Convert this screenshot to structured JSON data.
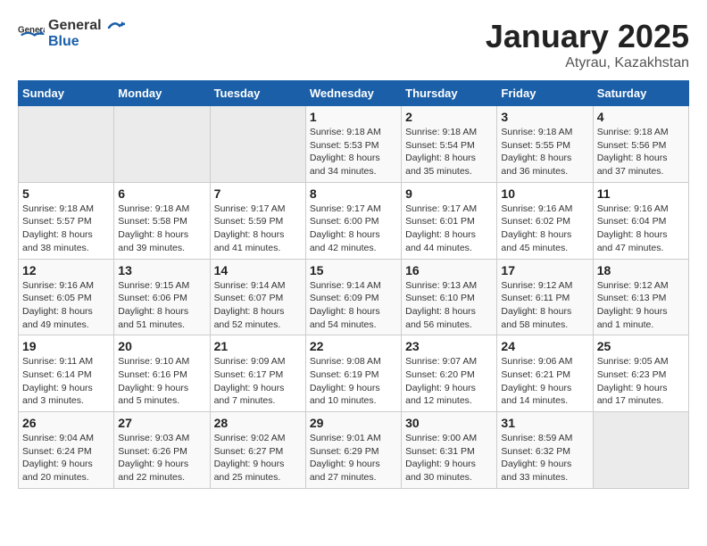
{
  "header": {
    "logo_general": "General",
    "logo_blue": "Blue",
    "title": "January 2025",
    "subtitle": "Atyrau, Kazakhstan"
  },
  "weekdays": [
    "Sunday",
    "Monday",
    "Tuesday",
    "Wednesday",
    "Thursday",
    "Friday",
    "Saturday"
  ],
  "weeks": [
    [
      {
        "day": "",
        "sunrise": "",
        "sunset": "",
        "daylight": ""
      },
      {
        "day": "",
        "sunrise": "",
        "sunset": "",
        "daylight": ""
      },
      {
        "day": "",
        "sunrise": "",
        "sunset": "",
        "daylight": ""
      },
      {
        "day": "1",
        "sunrise": "Sunrise: 9:18 AM",
        "sunset": "Sunset: 5:53 PM",
        "daylight": "Daylight: 8 hours and 34 minutes."
      },
      {
        "day": "2",
        "sunrise": "Sunrise: 9:18 AM",
        "sunset": "Sunset: 5:54 PM",
        "daylight": "Daylight: 8 hours and 35 minutes."
      },
      {
        "day": "3",
        "sunrise": "Sunrise: 9:18 AM",
        "sunset": "Sunset: 5:55 PM",
        "daylight": "Daylight: 8 hours and 36 minutes."
      },
      {
        "day": "4",
        "sunrise": "Sunrise: 9:18 AM",
        "sunset": "Sunset: 5:56 PM",
        "daylight": "Daylight: 8 hours and 37 minutes."
      }
    ],
    [
      {
        "day": "5",
        "sunrise": "Sunrise: 9:18 AM",
        "sunset": "Sunset: 5:57 PM",
        "daylight": "Daylight: 8 hours and 38 minutes."
      },
      {
        "day": "6",
        "sunrise": "Sunrise: 9:18 AM",
        "sunset": "Sunset: 5:58 PM",
        "daylight": "Daylight: 8 hours and 39 minutes."
      },
      {
        "day": "7",
        "sunrise": "Sunrise: 9:17 AM",
        "sunset": "Sunset: 5:59 PM",
        "daylight": "Daylight: 8 hours and 41 minutes."
      },
      {
        "day": "8",
        "sunrise": "Sunrise: 9:17 AM",
        "sunset": "Sunset: 6:00 PM",
        "daylight": "Daylight: 8 hours and 42 minutes."
      },
      {
        "day": "9",
        "sunrise": "Sunrise: 9:17 AM",
        "sunset": "Sunset: 6:01 PM",
        "daylight": "Daylight: 8 hours and 44 minutes."
      },
      {
        "day": "10",
        "sunrise": "Sunrise: 9:16 AM",
        "sunset": "Sunset: 6:02 PM",
        "daylight": "Daylight: 8 hours and 45 minutes."
      },
      {
        "day": "11",
        "sunrise": "Sunrise: 9:16 AM",
        "sunset": "Sunset: 6:04 PM",
        "daylight": "Daylight: 8 hours and 47 minutes."
      }
    ],
    [
      {
        "day": "12",
        "sunrise": "Sunrise: 9:16 AM",
        "sunset": "Sunset: 6:05 PM",
        "daylight": "Daylight: 8 hours and 49 minutes."
      },
      {
        "day": "13",
        "sunrise": "Sunrise: 9:15 AM",
        "sunset": "Sunset: 6:06 PM",
        "daylight": "Daylight: 8 hours and 51 minutes."
      },
      {
        "day": "14",
        "sunrise": "Sunrise: 9:14 AM",
        "sunset": "Sunset: 6:07 PM",
        "daylight": "Daylight: 8 hours and 52 minutes."
      },
      {
        "day": "15",
        "sunrise": "Sunrise: 9:14 AM",
        "sunset": "Sunset: 6:09 PM",
        "daylight": "Daylight: 8 hours and 54 minutes."
      },
      {
        "day": "16",
        "sunrise": "Sunrise: 9:13 AM",
        "sunset": "Sunset: 6:10 PM",
        "daylight": "Daylight: 8 hours and 56 minutes."
      },
      {
        "day": "17",
        "sunrise": "Sunrise: 9:12 AM",
        "sunset": "Sunset: 6:11 PM",
        "daylight": "Daylight: 8 hours and 58 minutes."
      },
      {
        "day": "18",
        "sunrise": "Sunrise: 9:12 AM",
        "sunset": "Sunset: 6:13 PM",
        "daylight": "Daylight: 9 hours and 1 minute."
      }
    ],
    [
      {
        "day": "19",
        "sunrise": "Sunrise: 9:11 AM",
        "sunset": "Sunset: 6:14 PM",
        "daylight": "Daylight: 9 hours and 3 minutes."
      },
      {
        "day": "20",
        "sunrise": "Sunrise: 9:10 AM",
        "sunset": "Sunset: 6:16 PM",
        "daylight": "Daylight: 9 hours and 5 minutes."
      },
      {
        "day": "21",
        "sunrise": "Sunrise: 9:09 AM",
        "sunset": "Sunset: 6:17 PM",
        "daylight": "Daylight: 9 hours and 7 minutes."
      },
      {
        "day": "22",
        "sunrise": "Sunrise: 9:08 AM",
        "sunset": "Sunset: 6:19 PM",
        "daylight": "Daylight: 9 hours and 10 minutes."
      },
      {
        "day": "23",
        "sunrise": "Sunrise: 9:07 AM",
        "sunset": "Sunset: 6:20 PM",
        "daylight": "Daylight: 9 hours and 12 minutes."
      },
      {
        "day": "24",
        "sunrise": "Sunrise: 9:06 AM",
        "sunset": "Sunset: 6:21 PM",
        "daylight": "Daylight: 9 hours and 14 minutes."
      },
      {
        "day": "25",
        "sunrise": "Sunrise: 9:05 AM",
        "sunset": "Sunset: 6:23 PM",
        "daylight": "Daylight: 9 hours and 17 minutes."
      }
    ],
    [
      {
        "day": "26",
        "sunrise": "Sunrise: 9:04 AM",
        "sunset": "Sunset: 6:24 PM",
        "daylight": "Daylight: 9 hours and 20 minutes."
      },
      {
        "day": "27",
        "sunrise": "Sunrise: 9:03 AM",
        "sunset": "Sunset: 6:26 PM",
        "daylight": "Daylight: 9 hours and 22 minutes."
      },
      {
        "day": "28",
        "sunrise": "Sunrise: 9:02 AM",
        "sunset": "Sunset: 6:27 PM",
        "daylight": "Daylight: 9 hours and 25 minutes."
      },
      {
        "day": "29",
        "sunrise": "Sunrise: 9:01 AM",
        "sunset": "Sunset: 6:29 PM",
        "daylight": "Daylight: 9 hours and 27 minutes."
      },
      {
        "day": "30",
        "sunrise": "Sunrise: 9:00 AM",
        "sunset": "Sunset: 6:31 PM",
        "daylight": "Daylight: 9 hours and 30 minutes."
      },
      {
        "day": "31",
        "sunrise": "Sunrise: 8:59 AM",
        "sunset": "Sunset: 6:32 PM",
        "daylight": "Daylight: 9 hours and 33 minutes."
      },
      {
        "day": "",
        "sunrise": "",
        "sunset": "",
        "daylight": ""
      }
    ]
  ]
}
